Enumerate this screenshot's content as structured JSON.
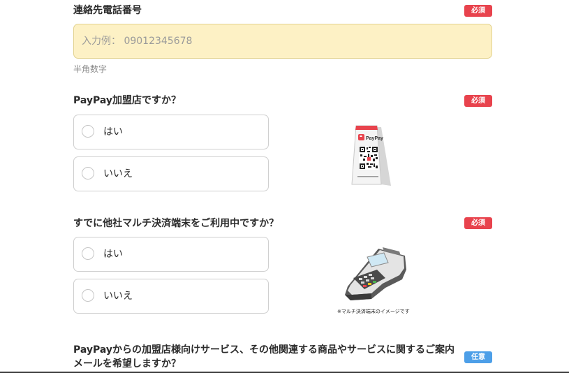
{
  "phone": {
    "title": "連絡先電話番号",
    "badge": "必須",
    "placeholder": "入力例： 09012345678",
    "hint": "半角数字"
  },
  "paypay_merchant": {
    "title": "PayPay加盟店ですか？",
    "badge": "必須",
    "options": [
      "はい",
      "いいえ"
    ],
    "stand_label": "PayPay"
  },
  "multi_terminal": {
    "title": "すでに他社マルチ決済端末をご利用中ですか？",
    "badge": "必須",
    "options": [
      "はい",
      "いいえ"
    ],
    "caption": "※マルチ決済端末のイメージです"
  },
  "newsletter": {
    "title_line1": "PayPayからの加盟店様向けサービス、その他関連する商品やサービスに関するご案内",
    "title_line2": "メールを希望しますか？",
    "badge": "任意"
  },
  "colors": {
    "required_badge": "#e8434d",
    "optional_badge": "#4d9fe8",
    "input_background": "#fdf1c5",
    "paypay_red": "#e8434d"
  }
}
